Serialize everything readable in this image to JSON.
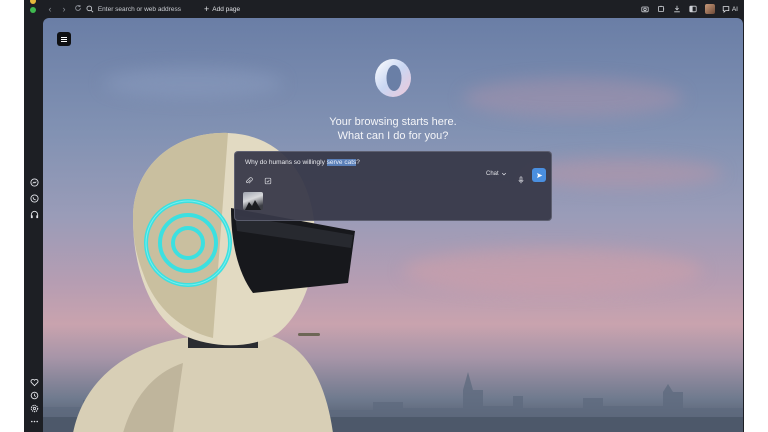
{
  "toolbar": {
    "address_placeholder": "Enter search or web address",
    "add_page_label": "Add page",
    "ai_label": "AI"
  },
  "main": {
    "headline_line1": "Your browsing starts here.",
    "headline_line2": "What can I do for you?"
  },
  "chat": {
    "prompt_before": "Why do humans so willingly ",
    "prompt_selected": "serve cats",
    "prompt_after": "?",
    "mode_label": "Chat"
  },
  "colors": {
    "accent": "#4a8fe0",
    "selection": "#5a7fb8",
    "window_bg": "#1d1f24"
  },
  "icons": {
    "sidebar_top": [
      "messenger-icon",
      "whatsapp-icon",
      "headphones-icon"
    ],
    "sidebar_bottom": [
      "heart-icon",
      "history-icon",
      "settings-icon",
      "more-icon"
    ],
    "toolbar_right": [
      "camera-icon",
      "extensions-icon",
      "download-icon",
      "sidebar-toggle-icon",
      "profile-avatar",
      "ai-chat-icon"
    ]
  }
}
